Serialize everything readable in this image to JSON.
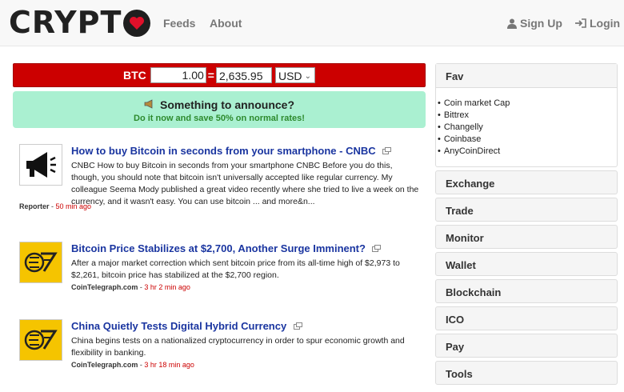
{
  "header": {
    "logo_text": "CRYPT",
    "nav": {
      "feeds": "Feeds",
      "about": "About"
    },
    "signup": "Sign Up",
    "login": "Login"
  },
  "converter": {
    "label": "BTC",
    "amount": "1.00",
    "equals": "=",
    "result": "2,635.95",
    "currency": "USD"
  },
  "announce": {
    "title": "Something to announce?",
    "subtitle": "Do it now and save 50% on normal rates!"
  },
  "news": [
    {
      "title": "How to buy Bitcoin in seconds from your smartphone - CNBC",
      "description": "CNBC How to buy Bitcoin in seconds from your smartphone CNBC Before you do this, though, you should note that bitcoin isn't universally accepted like regular currency. My colleague Seema Mody published a great video recently where she tried to live a week on the currency, and it wasn't easy. You can use bitcoin ... and more&n...",
      "source": "Reporter",
      "separator": " - ",
      "time": "50 min ago",
      "thumb_icon": "megaphone-icon"
    },
    {
      "title": "Bitcoin Price Stabilizes at $2,700, Another Surge Imminent?",
      "description": "After a major market correction which sent bitcoin price from its all-time high of $2,973 to $2,261, bitcoin price has stabilized at the $2,700 region.",
      "source": "CoinTelegraph.com",
      "separator": " - ",
      "time": "3 hr 2 min ago",
      "thumb_icon": "cointelegraph-logo-icon"
    },
    {
      "title": "China Quietly Tests Digital Hybrid Currency",
      "description": "China begins tests on a nationalized cryptocurrency in order to spur economic growth and flexibility in banking.",
      "source": "CoinTelegraph.com",
      "separator": " - ",
      "time": "3 hr 18 min ago",
      "thumb_icon": "cointelegraph-logo-icon"
    }
  ],
  "sidebar": {
    "fav": {
      "title": "Fav",
      "items": [
        "Coin market Cap",
        "Bittrex",
        "Changelly",
        "Coinbase",
        "AnyCoinDirect"
      ]
    },
    "panels": [
      "Exchange",
      "Trade",
      "Monitor",
      "Wallet",
      "Blockchain",
      "ICO",
      "Pay",
      "Tools"
    ]
  },
  "colors": {
    "converter_bg": "#cc0000",
    "announce_bg": "#aaf0d1",
    "link": "#1a35a0",
    "time": "#cc0000"
  }
}
